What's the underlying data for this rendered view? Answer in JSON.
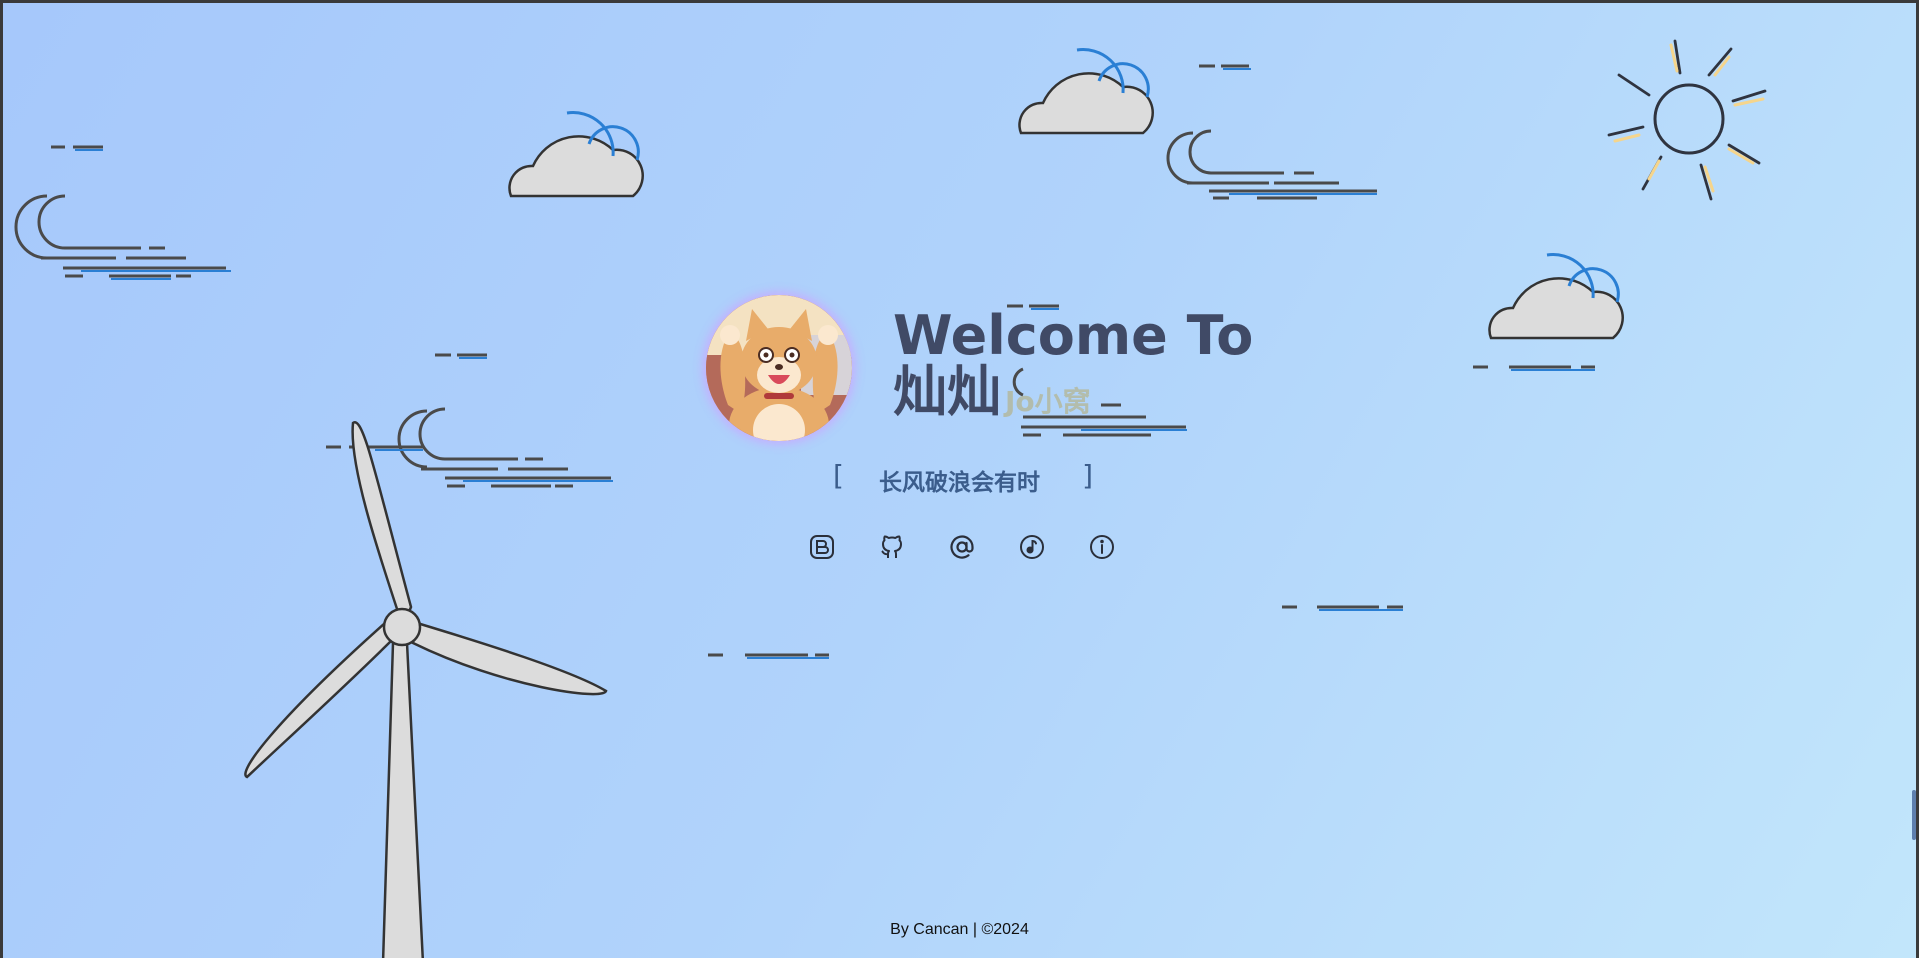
{
  "hero": {
    "title_line1": "Welcome To",
    "title_line2": "灿灿",
    "title_ghost": "Jo小窝",
    "motto_open": "[",
    "motto_text": "长风破浪会有时",
    "motto_close": "]"
  },
  "social_icons": [
    {
      "name": "blog-icon"
    },
    {
      "name": "github-icon"
    },
    {
      "name": "email-icon"
    },
    {
      "name": "music-icon"
    },
    {
      "name": "info-icon"
    }
  ],
  "footer": {
    "text": "By Cancan | ©2024"
  },
  "colors": {
    "background_start": "#a6c8fb",
    "background_end": "#c2e6fb",
    "title": "#404a66",
    "motto": "#3b5d8c",
    "highlight": "#f096be",
    "cloud_fill": "#dcdcdc",
    "cloud_accent": "#2a7fd4",
    "sun_ray_accent": "#f5d58c"
  }
}
